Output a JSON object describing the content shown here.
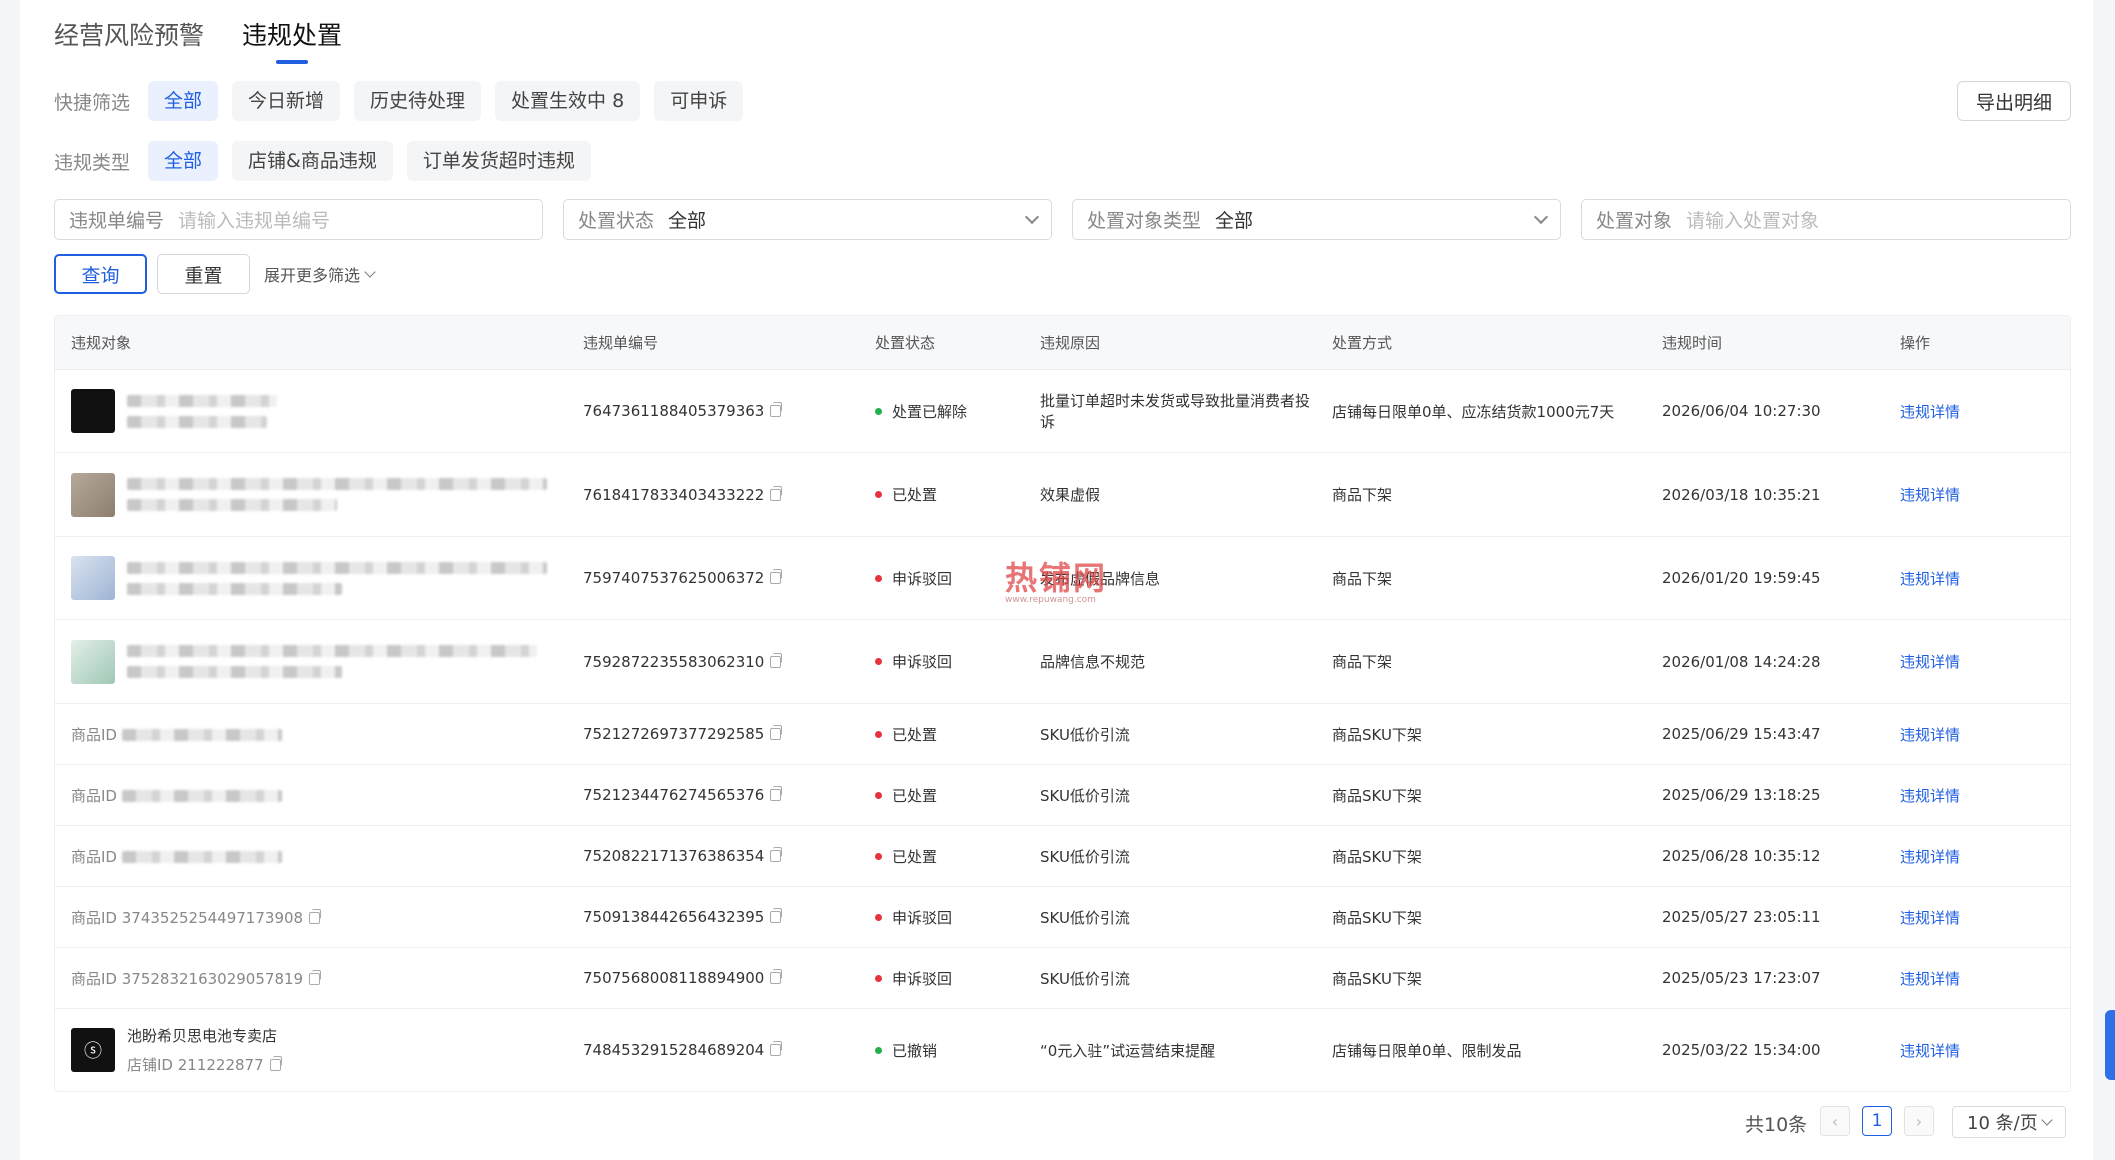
{
  "top_tabs": [
    {
      "label": "经营风险预警",
      "active": false
    },
    {
      "label": "违规处置",
      "active": true
    }
  ],
  "quick_filter": {
    "label": "快捷筛选",
    "chips": [
      "全部",
      "今日新增",
      "历史待处理",
      "处置生效中 8",
      "可申诉"
    ],
    "active_index": 0
  },
  "violation_type": {
    "label": "违规类型",
    "chips": [
      "全部",
      "店铺&商品违规",
      "订单发货超时违规"
    ],
    "active_index": 0
  },
  "export_label": "导出明细",
  "search_fields": {
    "violation_no": {
      "label": "违规单编号",
      "placeholder": "请输入违规单编号"
    },
    "status": {
      "label": "处置状态",
      "value": "全部"
    },
    "target_type": {
      "label": "处置对象类型",
      "value": "全部"
    },
    "target": {
      "label": "处置对象",
      "placeholder": "请输入处置对象"
    }
  },
  "buttons": {
    "query": "查询",
    "reset": "重置",
    "more": "展开更多筛选"
  },
  "table": {
    "headers": [
      "违规对象",
      "违规单编号",
      "处置状态",
      "违规原因",
      "处置方式",
      "违规时间",
      "操作"
    ],
    "rows": [
      {
        "obj_type": "blurred-shop",
        "id": "7647361188405379363",
        "status": "处置已解除",
        "status_color": "#22b04b",
        "reason": "批量订单超时未发货或导致批量消费者投诉",
        "method": "店铺每日限单0单、应冻结货款1000元7天",
        "time": "2026/06/04 10:27:30",
        "op": "违规详情"
      },
      {
        "obj_type": "blurred-product",
        "id": "7618417833403433222",
        "status": "已处置",
        "status_color": "#e5343f",
        "reason": "效果虚假",
        "method": "商品下架",
        "time": "2026/03/18 10:35:21",
        "op": "违规详情"
      },
      {
        "obj_type": "blurred-product",
        "id": "7597407537625006372",
        "status": "申诉驳回",
        "status_color": "#e5343f",
        "reason": "发布虚假品牌信息",
        "method": "商品下架",
        "time": "2026/01/20 19:59:45",
        "op": "违规详情"
      },
      {
        "obj_type": "blurred-product",
        "id": "7592872235583062310",
        "status": "申诉驳回",
        "status_color": "#e5343f",
        "reason": "品牌信息不规范",
        "method": "商品下架",
        "time": "2026/01/08 14:24:28",
        "op": "违规详情"
      },
      {
        "obj_type": "product-id-blurred",
        "obj_label": "商品ID",
        "id": "7521272697377292585",
        "status": "已处置",
        "status_color": "#e5343f",
        "reason": "SKU低价引流",
        "method": "商品SKU下架",
        "time": "2025/06/29 15:43:47",
        "op": "违规详情"
      },
      {
        "obj_type": "product-id-blurred",
        "obj_label": "商品ID",
        "id": "7521234476274565376",
        "status": "已处置",
        "status_color": "#e5343f",
        "reason": "SKU低价引流",
        "method": "商品SKU下架",
        "time": "2025/06/29 13:18:25",
        "op": "违规详情"
      },
      {
        "obj_type": "product-id-blurred",
        "obj_label": "商品ID",
        "id": "7520822171376386354",
        "status": "已处置",
        "status_color": "#e5343f",
        "reason": "SKU低价引流",
        "method": "商品SKU下架",
        "time": "2025/06/28 10:35:12",
        "op": "违规详情"
      },
      {
        "obj_type": "product-id",
        "obj_label": "商品ID 3743525254497173908",
        "id": "7509138442656432395",
        "status": "申诉驳回",
        "status_color": "#e5343f",
        "reason": "SKU低价引流",
        "method": "商品SKU下架",
        "time": "2025/05/27 23:05:11",
        "op": "违规详情"
      },
      {
        "obj_type": "product-id",
        "obj_label": "商品ID 3752832163029057819",
        "id": "7507568008118894900",
        "status": "申诉驳回",
        "status_color": "#e5343f",
        "reason": "SKU低价引流",
        "method": "商品SKU下架",
        "time": "2025/05/23 17:23:07",
        "op": "违规详情"
      },
      {
        "obj_type": "shop",
        "obj_label": "池盼希贝思电池专卖店",
        "obj_sub": "店铺ID 211222877",
        "id": "7484532915284689204",
        "status": "已撤销",
        "status_color": "#22b04b",
        "reason": "“0元入驻”试运营结束提醒",
        "method": "店铺每日限单0单、限制发品",
        "time": "2025/03/22 15:34:00",
        "op": "违规详情"
      }
    ]
  },
  "pagination": {
    "total": "共10条",
    "current_page": "1",
    "page_size": "10 条/页"
  },
  "watermark": {
    "text": "热铺网",
    "sub": "www.repuwang.com"
  }
}
